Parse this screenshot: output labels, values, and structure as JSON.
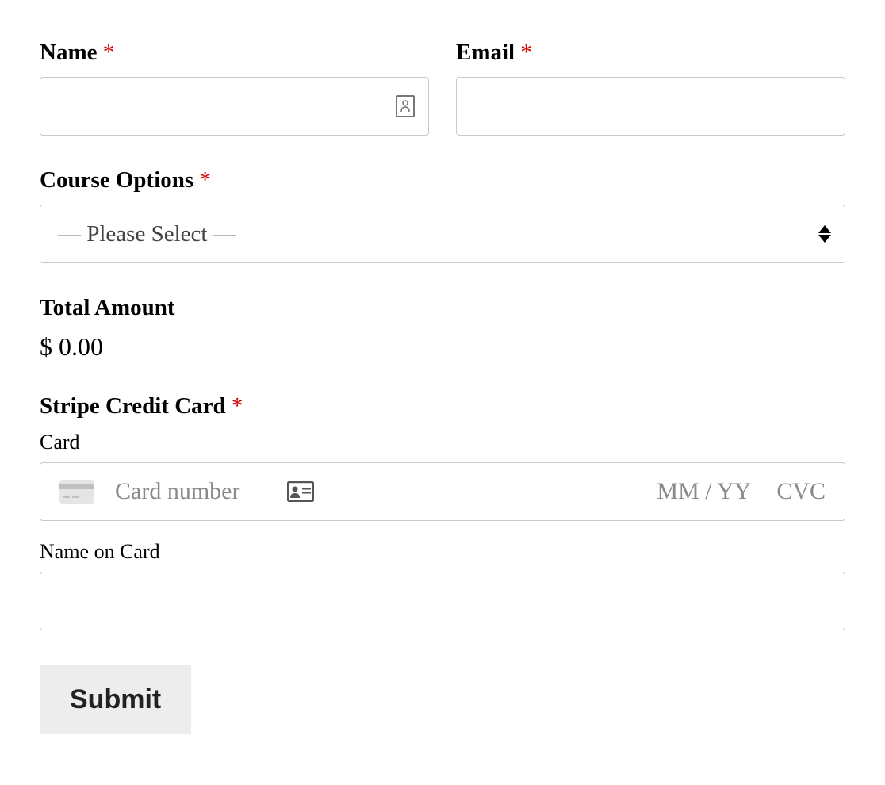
{
  "form": {
    "name": {
      "label": "Name",
      "required": "*",
      "value": ""
    },
    "email": {
      "label": "Email",
      "required": "*",
      "value": ""
    },
    "course_options": {
      "label": "Course Options",
      "required": "*",
      "placeholder": "— Please Select —"
    },
    "total": {
      "label": "Total Amount",
      "value": "$ 0.00"
    },
    "stripe": {
      "label": "Stripe Credit Card",
      "required": "*",
      "card_label": "Card",
      "card_number_placeholder": "Card number",
      "expiry_placeholder": "MM / YY",
      "cvc_placeholder": "CVC",
      "name_on_card_label": "Name on Card",
      "name_on_card_value": ""
    },
    "submit_label": "Submit"
  }
}
